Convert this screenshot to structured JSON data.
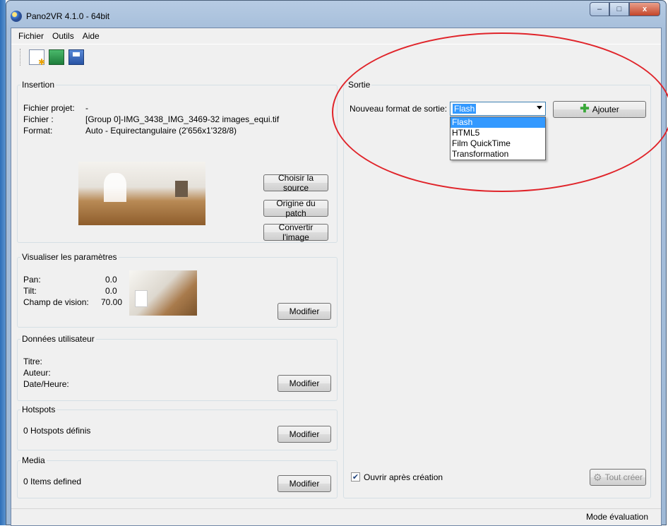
{
  "window": {
    "title": "Pano2VR 4.1.0 - 64bit",
    "min_glyph": "–",
    "max_glyph": "□",
    "close_glyph": "x"
  },
  "menu": [
    "Fichier",
    "Outils",
    "Aide"
  ],
  "insertion": {
    "title": "Insertion",
    "project_label": "Fichier projet:",
    "project_value": "-",
    "file_label": "Fichier :",
    "file_value": "[Group 0]-IMG_3438_IMG_3469-32 images_equi.tif",
    "format_label": "Format:",
    "format_value": "Auto - Equirectangulaire (2'656x1'328/8)",
    "btn_source": "Choisir la source",
    "btn_patch": "Origine du patch",
    "btn_convert": "Convertir l'image"
  },
  "view_params": {
    "title": "Visualiser les paramètres",
    "pan_label": "Pan:",
    "pan_value": "0.0",
    "tilt_label": "Tilt:",
    "tilt_value": "0.0",
    "fov_label": "Champ de vision:",
    "fov_value": "70.00",
    "btn_modify": "Modifier"
  },
  "user_data": {
    "title": "Données utilisateur",
    "title_label": "Titre:",
    "author_label": "Auteur:",
    "date_label": "Date/Heure:",
    "btn_modify": "Modifier"
  },
  "hotspots": {
    "title": "Hotspots",
    "count_text": "0 Hotspots définis",
    "btn_modify": "Modifier"
  },
  "media": {
    "title": "Media",
    "count_text": "0 Items defined",
    "btn_modify": "Modifier"
  },
  "output": {
    "title": "Sortie",
    "format_label": "Nouveau format de sortie:",
    "selected": "Flash",
    "options": [
      "Flash",
      "HTML5",
      "Film QuickTime",
      "Transformation"
    ],
    "btn_add": "Ajouter",
    "open_after_label": "Ouvrir après création",
    "open_after_checked": true,
    "btn_create_all": "Tout créer"
  },
  "status": {
    "mode": "Mode évaluation"
  },
  "colors": {
    "annotation": "#e0242a",
    "selection": "#3399ff"
  }
}
